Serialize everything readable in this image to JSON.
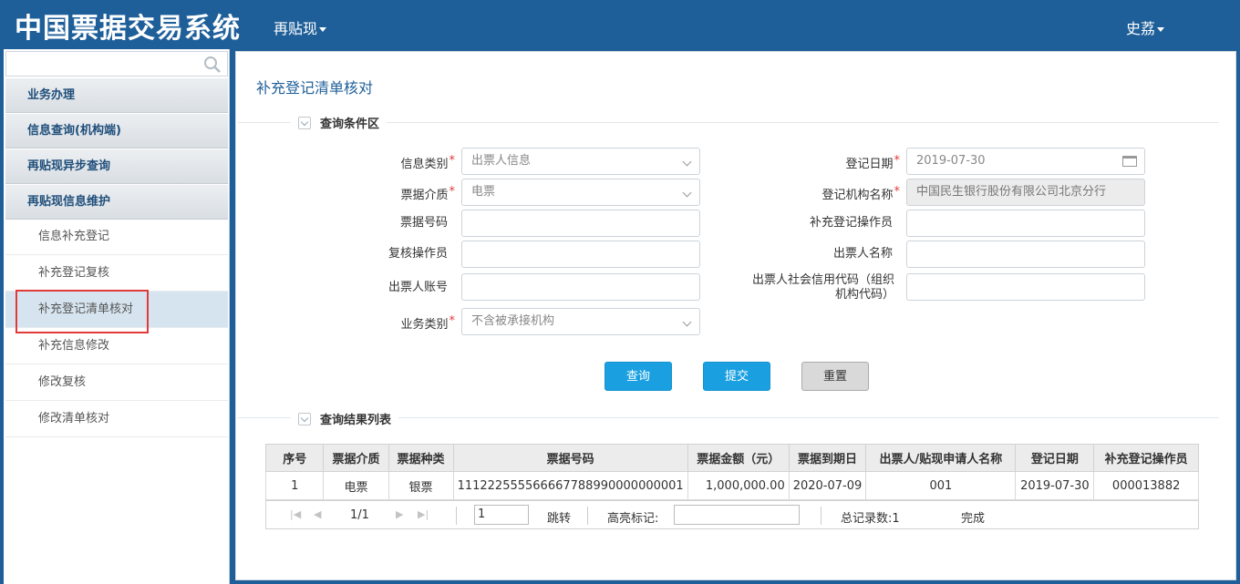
{
  "header": {
    "app_title": "中国票据交易系统",
    "module_menu": "再贴现",
    "user_menu": "史荔"
  },
  "sidebar": {
    "search_placeholder": "",
    "groups": [
      {
        "label": "业务办理"
      },
      {
        "label": "信息查询(机构端)"
      },
      {
        "label": "再贴现异步查询"
      },
      {
        "label": "再贴现信息维护"
      }
    ],
    "items": [
      {
        "label": "信息补充登记"
      },
      {
        "label": "补充登记复核"
      },
      {
        "label": "补充登记清单核对",
        "active": true
      },
      {
        "label": "补充信息修改"
      },
      {
        "label": "修改复核"
      },
      {
        "label": "修改清单核对"
      }
    ]
  },
  "page": {
    "title": "补充登记清单核对",
    "query_section": "查询条件区",
    "result_section": "查询结果列表"
  },
  "form": {
    "info_type": {
      "label": "信息类别",
      "value": "出票人信息"
    },
    "bill_medium": {
      "label": "票据介质",
      "value": "电票"
    },
    "bill_no": {
      "label": "票据号码",
      "value": ""
    },
    "reviewer": {
      "label": "复核操作员",
      "value": ""
    },
    "drawer_account": {
      "label": "出票人账号",
      "value": ""
    },
    "biz_type": {
      "label": "业务类别",
      "value": "不含被承接机构"
    },
    "reg_date": {
      "label": "登记日期",
      "value": "2019-07-30"
    },
    "reg_org": {
      "label": "登记机构名称",
      "value": "中国民生银行股份有限公司北京分行"
    },
    "supp_operator": {
      "label": "补充登记操作员",
      "value": ""
    },
    "drawer_name": {
      "label": "出票人名称",
      "value": ""
    },
    "credit_code": {
      "label_line1": "出票人社会信用代码（组织",
      "label_line2": "机构代码）",
      "value": ""
    }
  },
  "buttons": {
    "query": "查询",
    "submit": "提交",
    "reset": "重置"
  },
  "table": {
    "columns": [
      "序号",
      "票据介质",
      "票据种类",
      "票据号码",
      "票据金额（元）",
      "票据到期日",
      "出票人/贴现申请人名称",
      "登记日期",
      "补充登记操作员"
    ],
    "rows": [
      [
        "1",
        "电票",
        "银票",
        "111222555566667788990000000001",
        "1,000,000.00",
        "2020-07-09",
        "001",
        "2019-07-30",
        "000013882"
      ]
    ]
  },
  "pager": {
    "page_info": "1/1",
    "goto_value": "1",
    "goto_label": "跳转",
    "highlight_label": "高亮标记:",
    "total_label": "总记录数:1",
    "status": "完成"
  },
  "colors": {
    "header_bg": "#1f5f99",
    "accent_blue": "#1aa0e0",
    "required_red": "#e23a3a"
  }
}
